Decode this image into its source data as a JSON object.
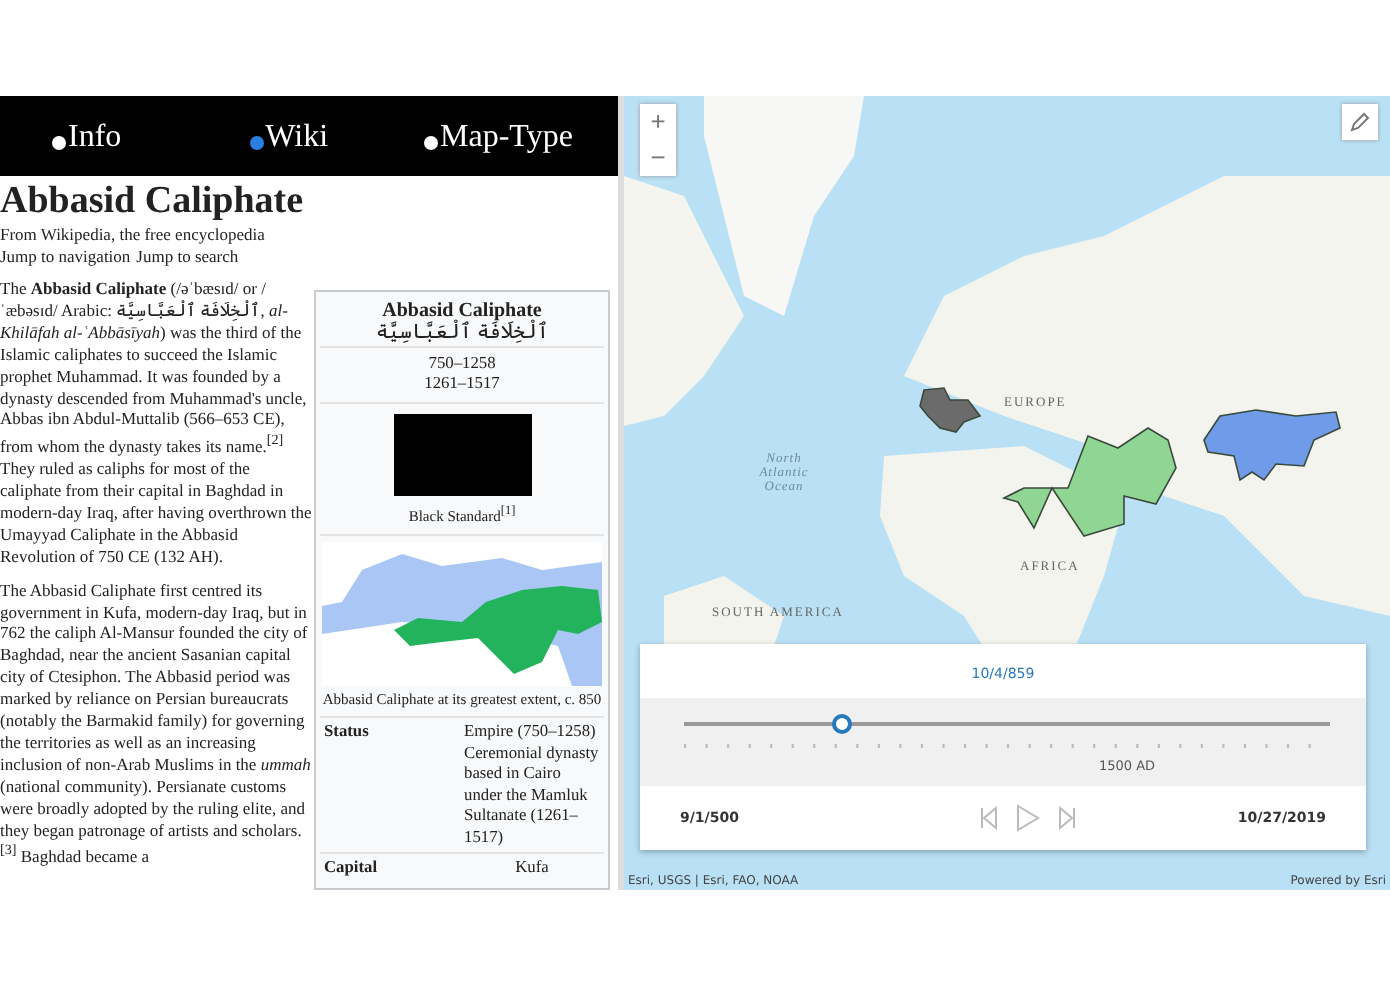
{
  "nav": {
    "items": [
      {
        "label": "Info",
        "selected": false
      },
      {
        "label": "Wiki",
        "selected": true
      },
      {
        "label": "Map-Type",
        "selected": false
      }
    ]
  },
  "article": {
    "title": "Abbasid Caliphate",
    "tagline": "From Wikipedia, the free encyclopedia",
    "jump_links": [
      "Jump to navigation",
      "Jump to search"
    ],
    "paragraphs": [
      "The **Abbasid Caliphate** (/əˈbæsɪd/ or /ˈæbəsɪd/ Arabic: ٱلْخِلَافَة ٱلْعَبَّاسِيَّة, *al-Khilāfah al-ʿAbbāsīyah*) was the third of the Islamic caliphates to succeed the Islamic prophet Muhammad. It was founded by a dynasty descended from Muhammad's uncle, Abbas ibn Abdul-Muttalib (566–653 CE), from whom the dynasty takes its name.$^{[2]}$ They ruled as caliphs for most of the caliphate from their capital in Baghdad in modern-day Iraq, after having overthrown the Umayyad Caliphate in the Abbasid Revolution of 750 CE (132 AH).",
      "The Abbasid Caliphate first centred its government in Kufa, modern-day Iraq, but in 762 the caliph Al-Mansur founded the city of Baghdad, near the ancient Sasanian capital city of Ctesiphon. The Abbasid period was marked by reliance on Persian bureaucrats (notably the Barmakid family) for governing the territories as well as an increasing inclusion of non-Arab Muslims in the *ummah* (national community). Persianate customs were broadly adopted by the ruling elite, and they began patronage of artists and scholars.$^{[3]}$ Baghdad became a"
    ],
    "infobox": {
      "title": "Abbasid Caliphate",
      "native_name": "ٱلْخِلَافَة ٱلْعَبَّاسِيَّة",
      "dates": [
        "750–1258",
        "1261–1517"
      ],
      "flag_caption": "Black Standard$^{[1]}$",
      "map_caption": "Abbasid Caliphate at its greatest extent, c. 850",
      "rows": [
        {
          "label": "Status",
          "value": "Empire (750–1258) Ceremonial dynasty based in Cairo under the Mamluk Sultanate (1261–1517)"
        },
        {
          "label": "Capital",
          "value": "Kufa"
        }
      ]
    }
  },
  "map": {
    "zoom_in": "+",
    "zoom_out": "−",
    "labels": [
      "EUROPE",
      "North Atlantic Ocean",
      "AFRICA",
      "SOUTH AMERICA"
    ],
    "regions": [
      {
        "color": "#6b6b6b"
      },
      {
        "color": "#8fd694"
      },
      {
        "color": "#6f9be8"
      }
    ],
    "time_slider": {
      "current": "10/4/859",
      "level": 0.24,
      "tick_label": "1500 AD",
      "start": "9/1/500",
      "end": "10/27/2019"
    },
    "attribution": "Esri, USGS | Esri, FAO, NOAA",
    "powered_by": "Powered by Esri"
  }
}
